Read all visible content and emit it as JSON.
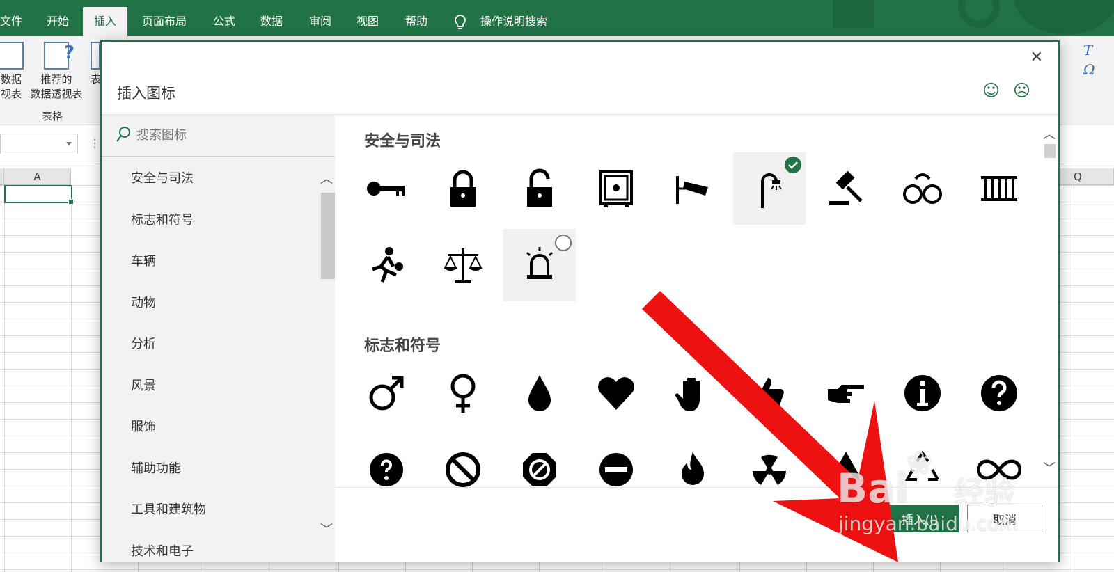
{
  "ribbon": {
    "tabs": [
      "文件",
      "开始",
      "插入",
      "页面布局",
      "公式",
      "数据",
      "审阅",
      "视图",
      "帮助"
    ],
    "active_tab": "插入",
    "tell_me": "操作说明搜索",
    "buttons": [
      {
        "line1": "数据",
        "line2": "视表"
      },
      {
        "line1": "推荐的",
        "line2": "数据透视表"
      },
      {
        "line1": "表",
        "line2": ""
      }
    ],
    "group_label": "表格"
  },
  "sheet": {
    "columns": [
      "A",
      "Q"
    ]
  },
  "dialog": {
    "title": "插入图标",
    "close": "✕",
    "smile": "☺",
    "frown": "☹",
    "search_placeholder": "搜索图标",
    "categories": [
      "安全与司法",
      "标志和符号",
      "车辆",
      "动物",
      "分析",
      "风景",
      "服饰",
      "辅助功能",
      "工具和建筑物",
      "技术和电子"
    ],
    "sections": [
      {
        "title": "安全与司法",
        "icons": [
          "key-icon",
          "lock-icon",
          "unlock-icon",
          "safe-icon",
          "security-camera-icon",
          "street-light-icon",
          "gavel-icon",
          "handcuffs-icon",
          "jail-icon",
          "thief-icon",
          "scales-icon",
          "siren-icon"
        ]
      },
      {
        "title": "标志和符号",
        "icons": [
          "male-icon",
          "female-icon",
          "drop-icon",
          "heart-icon",
          "hand-icon",
          "thumbs-up-icon",
          "pointing-hand-icon",
          "info-icon",
          "question-icon",
          "question-bubble-icon",
          "no-icon",
          "forbidden-icon",
          "no-entry-icon",
          "fire-icon",
          "radioactive-icon",
          "warning-icon",
          "recycle-icon",
          "infinity-icon"
        ]
      }
    ],
    "selected_icon": "street-light-icon",
    "insert_label": "插入(I)",
    "cancel_label": "取消"
  },
  "watermark": {
    "brand": "Bai",
    "brand_cn": "经验",
    "url": "jingyan.baidu.com"
  },
  "colors": {
    "excel_green": "#217346",
    "arrow_red": "#ee1111"
  }
}
